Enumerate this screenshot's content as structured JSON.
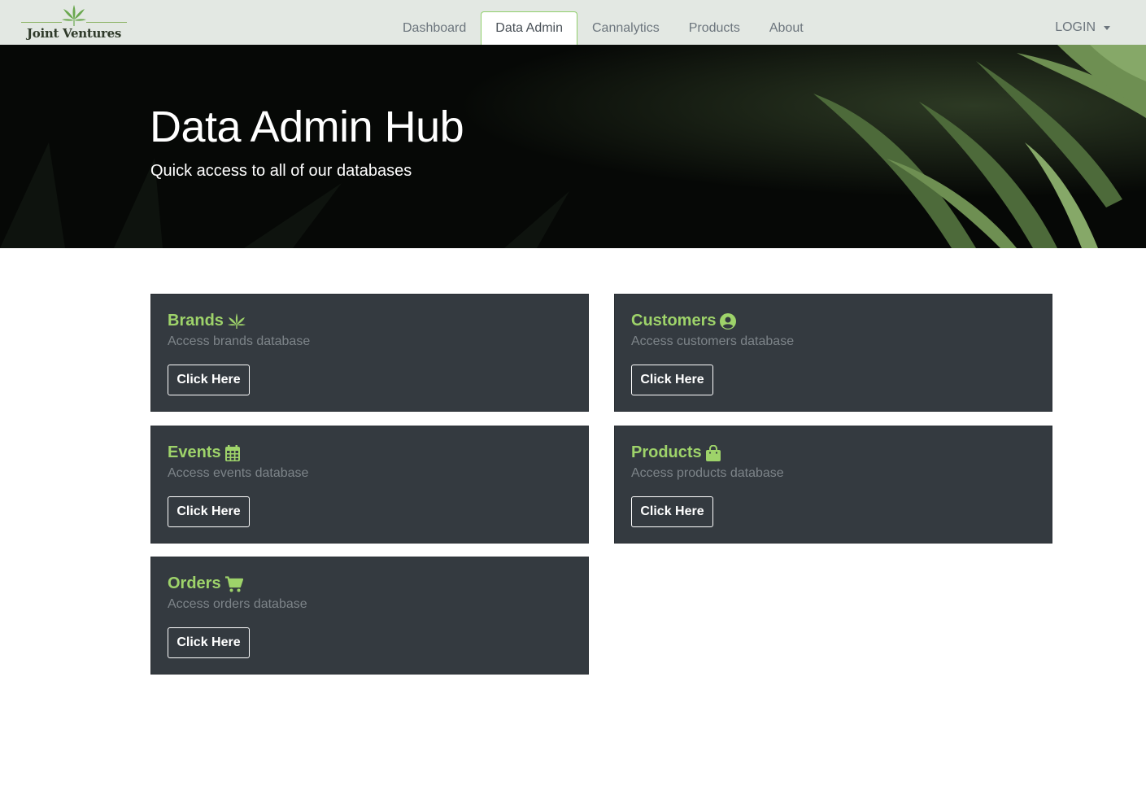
{
  "brand": {
    "name": "Joint Ventures",
    "accent_color": "#8fcf6a"
  },
  "nav": {
    "items": [
      {
        "label": "Dashboard",
        "active": false
      },
      {
        "label": "Data Admin",
        "active": true
      },
      {
        "label": "Cannalytics",
        "active": false
      },
      {
        "label": "Products",
        "active": false
      },
      {
        "label": "About",
        "active": false
      }
    ],
    "login_label": "LOGIN"
  },
  "hero": {
    "title": "Data Admin Hub",
    "subtitle": "Quick access to all of our databases"
  },
  "cards": [
    {
      "title": "Brands",
      "icon": "cannabis-leaf-icon",
      "subtitle": "Access brands database",
      "button": "Click Here"
    },
    {
      "title": "Customers",
      "icon": "user-circle-icon",
      "subtitle": "Access customers database",
      "button": "Click Here"
    },
    {
      "title": "Events",
      "icon": "calendar-icon",
      "subtitle": "Access events database",
      "button": "Click Here"
    },
    {
      "title": "Products",
      "icon": "shopping-bag-icon",
      "subtitle": "Access products database",
      "button": "Click Here"
    },
    {
      "title": "Orders",
      "icon": "shopping-cart-icon",
      "subtitle": "Access orders database",
      "button": "Click Here"
    }
  ],
  "colors": {
    "card_bg": "#343a40",
    "title_green": "#9ed36a",
    "navbar_bg": "#e3e8e3"
  }
}
